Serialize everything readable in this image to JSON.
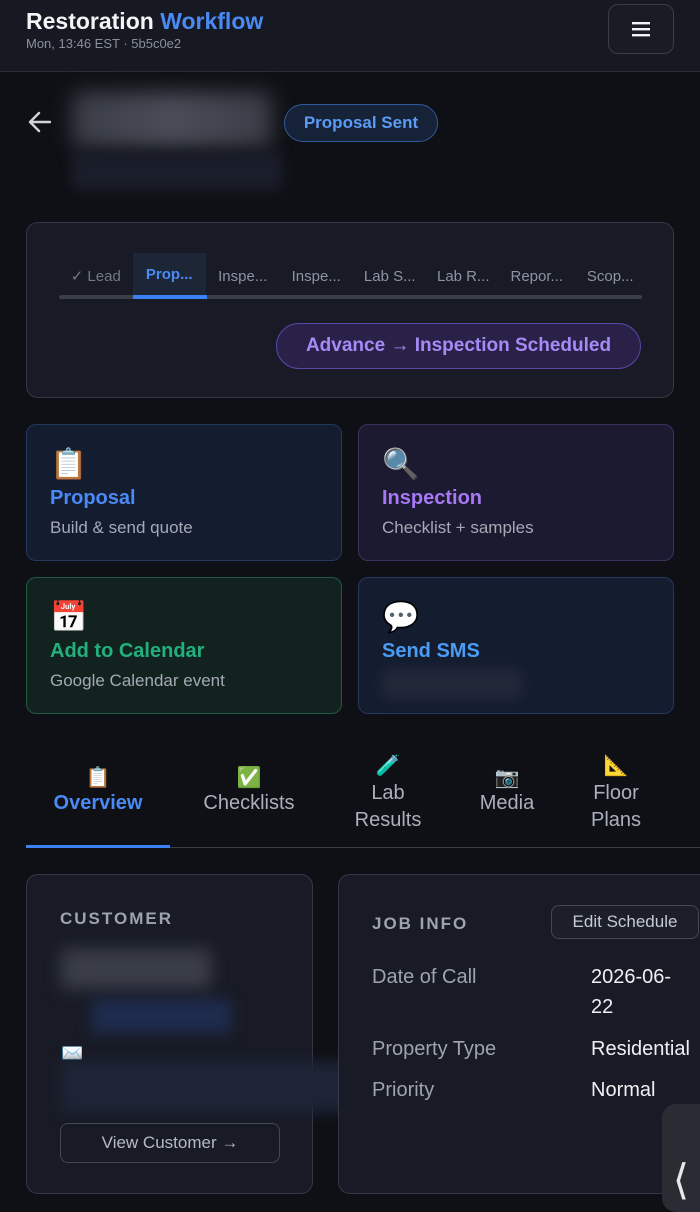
{
  "header": {
    "brand_primary": "Restoration",
    "brand_accent": "Workflow",
    "subtitle": "Mon, 13:46 EST · 5b5c0e2",
    "menu_icon": "hamburger-icon"
  },
  "job": {
    "status": "Proposal Sent"
  },
  "pipeline": {
    "stages": [
      {
        "label": "✓ Lead",
        "state": "done"
      },
      {
        "label": "Prop...",
        "state": "active"
      },
      {
        "label": "Inspe...",
        "state": "pending"
      },
      {
        "label": "Inspe...",
        "state": "pending"
      },
      {
        "label": "Lab S...",
        "state": "pending"
      },
      {
        "label": "Lab R...",
        "state": "pending"
      },
      {
        "label": "Repor...",
        "state": "pending"
      },
      {
        "label": "Scop...",
        "state": "pending"
      }
    ],
    "advance_label": "Advance → Inspection Scheduled"
  },
  "actions": {
    "proposal": {
      "icon": "📋",
      "title": "Proposal",
      "subtitle": "Build & send quote"
    },
    "inspection": {
      "icon": "🔍",
      "title": "Inspection",
      "subtitle": "Checklist + samples"
    },
    "calendar": {
      "icon": "📅",
      "title": "Add to Calendar",
      "subtitle": "Google Calendar event"
    },
    "sms": {
      "icon": "💬",
      "title": "Send SMS"
    }
  },
  "tabs": [
    {
      "icon": "📋",
      "label": "Overview"
    },
    {
      "icon": "✅",
      "label": "Checklists"
    },
    {
      "icon": "🧪",
      "label": "Lab Results"
    },
    {
      "icon": "📷",
      "label": "Media"
    },
    {
      "icon": "📐",
      "label": "Floor Plans"
    }
  ],
  "customer": {
    "section_label": "CUSTOMER",
    "email_icon": "✉️",
    "view_button": "View Customer →"
  },
  "job_info": {
    "section_label": "JOB INFO",
    "edit_button": "Edit Schedule",
    "rows": [
      {
        "label": "Date of Call",
        "value": "2026-06-\n22"
      },
      {
        "label": "Property Type",
        "value": "Residential"
      },
      {
        "label": "Priority",
        "value": "Normal"
      }
    ]
  },
  "side_handle": "⟨",
  "colors": {
    "accent": "#3b82f6",
    "purple": "#a678f5",
    "green": "#22b07d",
    "background": "#0f1016"
  }
}
